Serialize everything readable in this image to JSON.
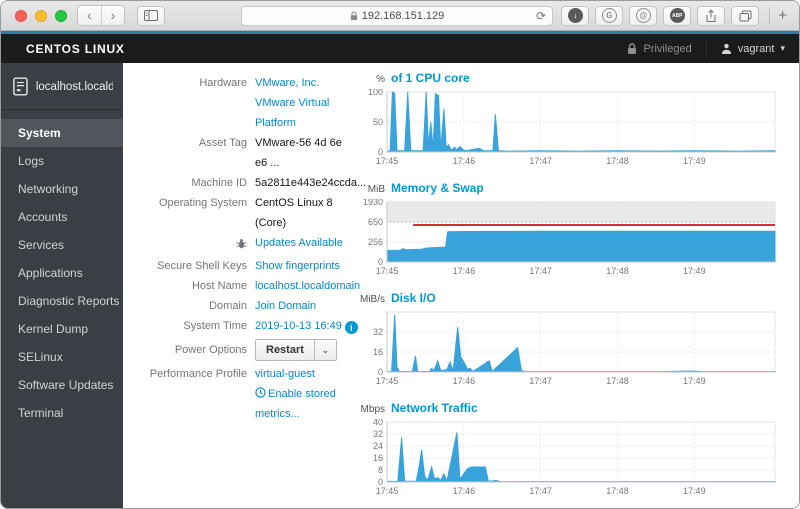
{
  "browser": {
    "url": "192.168.151.129",
    "icons": {
      "back": "‹",
      "forward": "›",
      "reload": "⟳",
      "new_tab": "+",
      "download_arrow": "↓",
      "g_badge": "G",
      "at_badge": "@",
      "abp_badge": "ABP"
    }
  },
  "masthead": {
    "brand": "CENTOS LINUX",
    "privileged_label": "Privileged",
    "user_name": "vagrant",
    "caret": "▾"
  },
  "sidebar": {
    "host": "localhost.locald...",
    "active_item": "System",
    "items": [
      {
        "label": "System"
      },
      {
        "label": "Logs"
      },
      {
        "label": "Networking"
      },
      {
        "label": "Accounts"
      },
      {
        "label": "Services"
      },
      {
        "label": "Applications"
      },
      {
        "label": "Diagnostic Reports"
      },
      {
        "label": "Kernel Dump"
      },
      {
        "label": "SELinux"
      },
      {
        "label": "Software Updates"
      },
      {
        "label": "Terminal"
      }
    ]
  },
  "system": {
    "hardware": {
      "label": "Hardware",
      "value": "VMware, Inc. VMware Virtual Platform"
    },
    "asset_tag": {
      "label": "Asset Tag",
      "value": "VMware-56 4d 6e e6 ..."
    },
    "machine_id": {
      "label": "Machine ID",
      "value": "5a2811e443e24ccda..."
    },
    "os": {
      "label": "Operating System",
      "value": "CentOS Linux 8 (Core)"
    },
    "updates": {
      "value": "Updates Available"
    },
    "ssh_keys": {
      "label": "Secure Shell Keys",
      "value": "Show fingerprints"
    },
    "hostname": {
      "label": "Host Name",
      "value": "localhost.localdomain"
    },
    "domain": {
      "label": "Domain",
      "value": "Join Domain"
    },
    "system_time": {
      "label": "System Time",
      "value": "2019-10-13 16:49",
      "info_glyph": "i"
    },
    "power": {
      "label": "Power Options",
      "button": "Restart",
      "caret": "⌄"
    },
    "profile": {
      "label": "Performance Profile",
      "value": "virtual-guest"
    },
    "stored_metrics": {
      "value": "Enable stored metrics..."
    }
  },
  "chart_data": [
    {
      "type": "area",
      "unit": "%",
      "title": "of 1 CPU core",
      "x_range_minutes": [
        0,
        5.05
      ],
      "x_ticks": [
        {
          "t": 0,
          "label": "17:45"
        },
        {
          "t": 1,
          "label": "17:46"
        },
        {
          "t": 2,
          "label": "17:47"
        },
        {
          "t": 3,
          "label": "17:48"
        },
        {
          "t": 4,
          "label": "17:49"
        }
      ],
      "y_scale": "linear",
      "ylim": [
        0,
        100
      ],
      "y_ticks": [
        {
          "v": 0,
          "label": "0"
        },
        {
          "v": 50,
          "label": "50"
        },
        {
          "v": 100,
          "label": "100"
        }
      ],
      "series": [
        {
          "name": "cpu-usage",
          "color": "#39a3dc",
          "points": [
            [
              0,
              1.5
            ],
            [
              0.04,
              1.5
            ],
            [
              0.07,
              100
            ],
            [
              0.1,
              98
            ],
            [
              0.13,
              2
            ],
            [
              0.23,
              2
            ],
            [
              0.27,
              100
            ],
            [
              0.31,
              2
            ],
            [
              0.47,
              2
            ],
            [
              0.51,
              100
            ],
            [
              0.54,
              10
            ],
            [
              0.57,
              50
            ],
            [
              0.6,
              6
            ],
            [
              0.63,
              97
            ],
            [
              0.67,
              94
            ],
            [
              0.7,
              5
            ],
            [
              0.74,
              72
            ],
            [
              0.77,
              8
            ],
            [
              0.8,
              12
            ],
            [
              0.84,
              3
            ],
            [
              0.88,
              8
            ],
            [
              0.91,
              4
            ],
            [
              0.95,
              9
            ],
            [
              1.0,
              3
            ],
            [
              1.05,
              2
            ],
            [
              1.1,
              4
            ],
            [
              1.15,
              5
            ],
            [
              1.18,
              6
            ],
            [
              1.22,
              5
            ],
            [
              1.26,
              2
            ],
            [
              1.38,
              2
            ],
            [
              1.41,
              63
            ],
            [
              1.45,
              2
            ],
            [
              1.6,
              1.5
            ],
            [
              2.0,
              2
            ],
            [
              2.5,
              1.5
            ],
            [
              3.0,
              2
            ],
            [
              3.5,
              1.5
            ],
            [
              4.0,
              2
            ],
            [
              4.6,
              1.5
            ],
            [
              5.05,
              2
            ]
          ]
        }
      ]
    },
    {
      "type": "area",
      "unit": "MiB",
      "title": "Memory & Swap",
      "x_range_minutes": [
        0,
        5.05
      ],
      "x_ticks": [
        {
          "t": 0,
          "label": "17:45"
        },
        {
          "t": 1,
          "label": "17:46"
        },
        {
          "t": 2,
          "label": "17:47"
        },
        {
          "t": 3,
          "label": "17:48"
        },
        {
          "t": 4,
          "label": "17:49"
        }
      ],
      "y_scale": "segmented",
      "y_stops": [
        0,
        256,
        650,
        1930
      ],
      "y_ticks": [
        {
          "v": 0,
          "label": "0"
        },
        {
          "v": 256,
          "label": "256"
        },
        {
          "v": 650,
          "label": "650"
        },
        {
          "v": 1930,
          "label": "1930"
        }
      ],
      "band": {
        "from": 650,
        "to": 1930,
        "color": "#e9e9e9",
        "edge": "#c2c2c2"
      },
      "threshold_line": {
        "name": "swap-limit",
        "value": 590,
        "start_t": 0.34,
        "color": "#cc3333"
      },
      "series": [
        {
          "name": "memory-used",
          "color": "#39a3dc",
          "points": [
            [
              0,
              148
            ],
            [
              0.17,
              150
            ],
            [
              0.21,
              170
            ],
            [
              0.25,
              158
            ],
            [
              0.33,
              160
            ],
            [
              0.45,
              162
            ],
            [
              0.5,
              178
            ],
            [
              0.57,
              182
            ],
            [
              0.7,
              188
            ],
            [
              0.76,
              190
            ],
            [
              0.79,
              458
            ],
            [
              0.9,
              460
            ],
            [
              1.2,
              465
            ],
            [
              2.0,
              466
            ],
            [
              5.05,
              467
            ]
          ]
        }
      ]
    },
    {
      "type": "area",
      "unit": "MiB/s",
      "title": "Disk I/O",
      "x_range_minutes": [
        0,
        5.05
      ],
      "x_ticks": [
        {
          "t": 0,
          "label": "17:45"
        },
        {
          "t": 1,
          "label": "17:46"
        },
        {
          "t": 2,
          "label": "17:47"
        },
        {
          "t": 3,
          "label": "17:48"
        },
        {
          "t": 4,
          "label": "17:49"
        }
      ],
      "y_scale": "linear",
      "ylim": [
        0,
        48
      ],
      "y_ticks": [
        {
          "v": 0,
          "label": "0"
        },
        {
          "v": 16,
          "label": "16"
        },
        {
          "v": 32,
          "label": "32"
        }
      ],
      "series": [
        {
          "name": "disk-io",
          "color": "#39a3dc",
          "points": [
            [
              0,
              0.3
            ],
            [
              0.06,
              0.3
            ],
            [
              0.1,
              46
            ],
            [
              0.13,
              4
            ],
            [
              0.16,
              0.4
            ],
            [
              0.33,
              0.4
            ],
            [
              0.37,
              13
            ],
            [
              0.4,
              0.5
            ],
            [
              0.55,
              0.4
            ],
            [
              0.58,
              3
            ],
            [
              0.61,
              1
            ],
            [
              0.66,
              9
            ],
            [
              0.7,
              1
            ],
            [
              0.78,
              2
            ],
            [
              0.82,
              8
            ],
            [
              0.86,
              1
            ],
            [
              0.92,
              36
            ],
            [
              0.96,
              12
            ],
            [
              1.0,
              8
            ],
            [
              1.05,
              2
            ],
            [
              1.08,
              3
            ],
            [
              1.12,
              0.5
            ],
            [
              1.33,
              9
            ],
            [
              1.37,
              0.5
            ],
            [
              1.7,
              19.5
            ],
            [
              1.75,
              1
            ],
            [
              1.8,
              0.3
            ],
            [
              2.5,
              0.3
            ],
            [
              3.5,
              0.3
            ],
            [
              4.0,
              0.8
            ],
            [
              4.1,
              0.3
            ],
            [
              5.05,
              0.3
            ]
          ]
        }
      ]
    },
    {
      "type": "area",
      "unit": "Mbps",
      "title": "Network Traffic",
      "x_range_minutes": [
        0,
        5.05
      ],
      "x_ticks": [
        {
          "t": 0,
          "label": "17:45"
        },
        {
          "t": 1,
          "label": "17:46"
        },
        {
          "t": 2,
          "label": "17:47"
        },
        {
          "t": 3,
          "label": "17:48"
        },
        {
          "t": 4,
          "label": "17:49"
        }
      ],
      "y_scale": "linear",
      "ylim": [
        0,
        40
      ],
      "y_ticks": [
        {
          "v": 0,
          "label": "0"
        },
        {
          "v": 8,
          "label": "8"
        },
        {
          "v": 16,
          "label": "16"
        },
        {
          "v": 24,
          "label": "24"
        },
        {
          "v": 32,
          "label": "32"
        },
        {
          "v": 40,
          "label": "40"
        }
      ],
      "series": [
        {
          "name": "network-traffic",
          "color": "#39a3dc",
          "points": [
            [
              0,
              0.4
            ],
            [
              0.14,
              0.4
            ],
            [
              0.19,
              29.5
            ],
            [
              0.23,
              0.5
            ],
            [
              0.38,
              0.5
            ],
            [
              0.42,
              11
            ],
            [
              0.45,
              21.5
            ],
            [
              0.49,
              4
            ],
            [
              0.53,
              1
            ],
            [
              0.58,
              10
            ],
            [
              0.62,
              2
            ],
            [
              0.66,
              3
            ],
            [
              0.7,
              1
            ],
            [
              0.74,
              5.5
            ],
            [
              0.78,
              0.5
            ],
            [
              0.91,
              33
            ],
            [
              0.95,
              2
            ],
            [
              1.05,
              9
            ],
            [
              1.1,
              10
            ],
            [
              1.28,
              10
            ],
            [
              1.32,
              0.5
            ],
            [
              1.42,
              1
            ],
            [
              1.48,
              0.3
            ],
            [
              2.5,
              0.3
            ],
            [
              3.5,
              0.3
            ],
            [
              5.05,
              0.3
            ]
          ]
        }
      ]
    }
  ]
}
